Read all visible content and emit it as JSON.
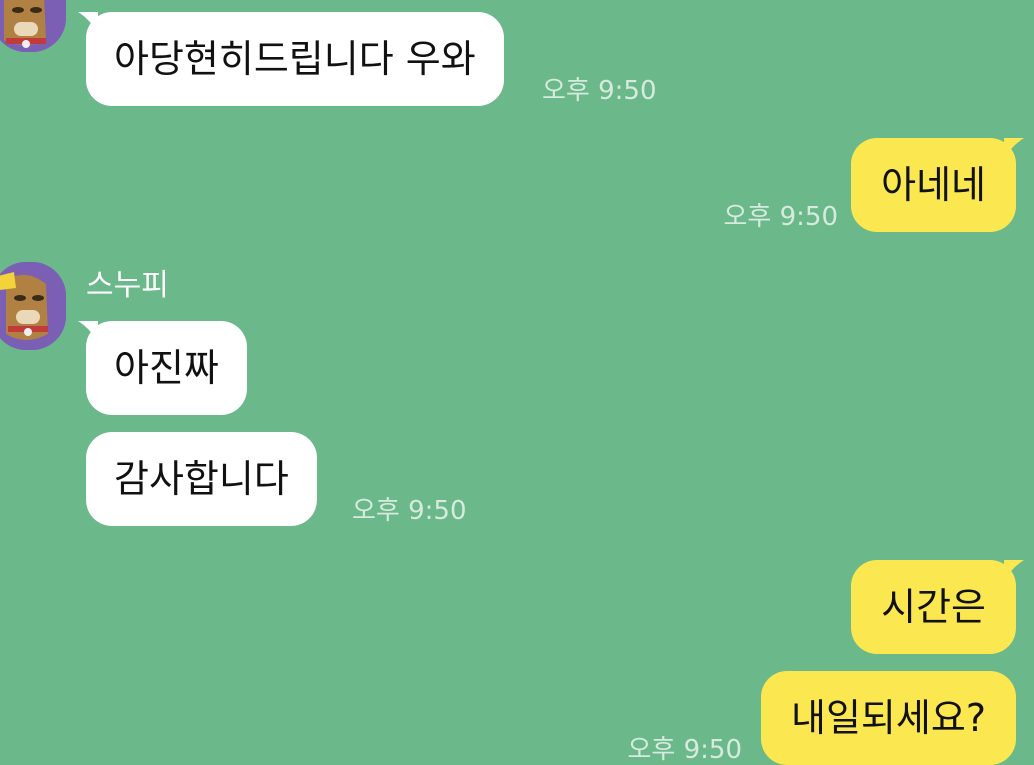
{
  "colors": {
    "background": "#6bb88b",
    "incoming_bubble": "#ffffff",
    "outgoing_bubble": "#fbe74f",
    "avatar_bg": "#7b5fb4",
    "timestamp": "#d6eadd"
  },
  "messages": [
    {
      "direction": "incoming",
      "text": "아당현히드립니다 우와",
      "time": "오후 9:50"
    },
    {
      "direction": "outgoing",
      "text": "아네네",
      "time": "오후 9:50"
    },
    {
      "direction": "incoming",
      "sender": "스누피",
      "avatar_icon": "dog-character-avatar-icon",
      "text": "아진짜"
    },
    {
      "direction": "incoming",
      "text": "감사합니다",
      "time": "오후 9:50"
    },
    {
      "direction": "outgoing",
      "text": "시간은"
    },
    {
      "direction": "outgoing",
      "text": "내일되세요?",
      "time": "오후 9:50"
    }
  ]
}
